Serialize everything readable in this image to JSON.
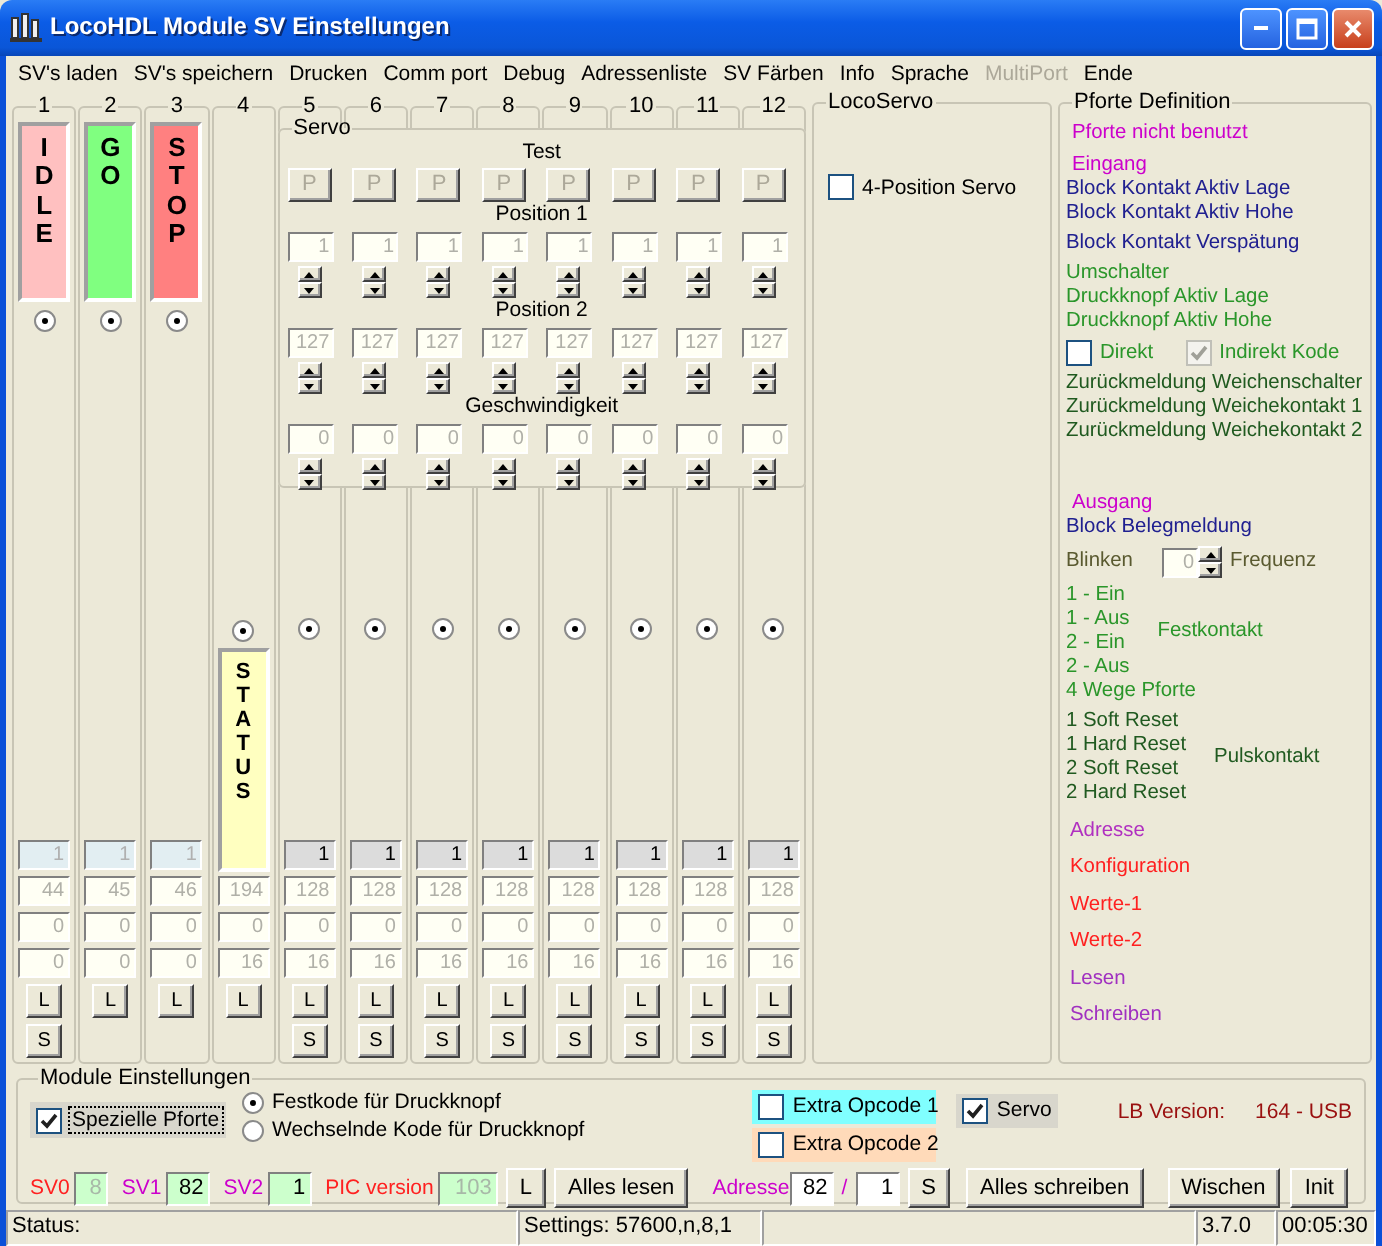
{
  "window": {
    "title": "LocoHDL Module SV Einstellungen"
  },
  "menu": [
    {
      "label": "SV's laden",
      "disabled": false
    },
    {
      "label": "SV's speichern",
      "disabled": false
    },
    {
      "label": "Drucken",
      "disabled": false
    },
    {
      "label": "Comm port",
      "disabled": false
    },
    {
      "label": "Debug",
      "disabled": false
    },
    {
      "label": "Adressenliste",
      "disabled": false
    },
    {
      "label": "SV Färben",
      "disabled": false
    },
    {
      "label": "Info",
      "disabled": false
    },
    {
      "label": "Sprache",
      "disabled": false
    },
    {
      "label": "MultiPort",
      "disabled": true
    },
    {
      "label": "Ende",
      "disabled": false
    }
  ],
  "ports": [
    {
      "number": "1",
      "kind": "state",
      "panel": {
        "text": "IDLE",
        "color": "#ffc0c0"
      },
      "selected": true,
      "top_field": {
        "value": "1",
        "disabled": true
      },
      "fields": [
        "44",
        "0",
        "0"
      ],
      "load": "L",
      "save": "S"
    },
    {
      "number": "2",
      "kind": "state",
      "panel": {
        "text": "GO",
        "color": "#80ff80"
      },
      "selected": true,
      "top_field": {
        "value": "1",
        "disabled": true
      },
      "fields": [
        "45",
        "0",
        "0"
      ],
      "load": "L"
    },
    {
      "number": "3",
      "kind": "state",
      "panel": {
        "text": "STOP",
        "color": "#ff8080"
      },
      "selected": true,
      "top_field": {
        "value": "1",
        "disabled": true
      },
      "fields": [
        "46",
        "0",
        "0"
      ],
      "load": "L"
    },
    {
      "number": "4",
      "kind": "status",
      "panel": {
        "text": "STATUS",
        "color": "#ffffc0"
      },
      "selected": true,
      "fields": [
        "194",
        "0",
        "16"
      ],
      "load": "L"
    },
    {
      "number": "5",
      "kind": "servo",
      "selected": true,
      "top_field": {
        "value": "1",
        "disabled": false
      },
      "fields": [
        "128",
        "0",
        "16"
      ],
      "load": "L",
      "save": "S"
    },
    {
      "number": "6",
      "kind": "servo",
      "selected": true,
      "top_field": {
        "value": "1",
        "disabled": false
      },
      "fields": [
        "128",
        "0",
        "16"
      ],
      "load": "L",
      "save": "S"
    },
    {
      "number": "7",
      "kind": "servo",
      "selected": true,
      "top_field": {
        "value": "1",
        "disabled": false
      },
      "fields": [
        "128",
        "0",
        "16"
      ],
      "load": "L",
      "save": "S"
    },
    {
      "number": "8",
      "kind": "servo",
      "selected": true,
      "top_field": {
        "value": "1",
        "disabled": false
      },
      "fields": [
        "128",
        "0",
        "16"
      ],
      "load": "L",
      "save": "S"
    },
    {
      "number": "9",
      "kind": "servo",
      "selected": true,
      "top_field": {
        "value": "1",
        "disabled": false
      },
      "fields": [
        "128",
        "0",
        "16"
      ],
      "load": "L",
      "save": "S"
    },
    {
      "number": "10",
      "kind": "servo",
      "selected": true,
      "top_field": {
        "value": "1",
        "disabled": false
      },
      "fields": [
        "128",
        "0",
        "16"
      ],
      "load": "L",
      "save": "S"
    },
    {
      "number": "11",
      "kind": "servo",
      "selected": true,
      "top_field": {
        "value": "1",
        "disabled": false
      },
      "fields": [
        "128",
        "0",
        "16"
      ],
      "load": "L",
      "save": "S"
    },
    {
      "number": "12",
      "kind": "servo",
      "selected": true,
      "top_field": {
        "value": "1",
        "disabled": false
      },
      "fields": [
        "128",
        "0",
        "16"
      ],
      "load": "L",
      "save": "S"
    }
  ],
  "servo": {
    "title": "Servo",
    "test_label": "Test",
    "test_buttons": [
      {
        "label": "P",
        "disabled": true
      },
      {
        "label": "P",
        "disabled": true
      },
      {
        "label": "P",
        "disabled": true
      },
      {
        "label": "P",
        "disabled": true
      },
      {
        "label": "P",
        "disabled": true
      },
      {
        "label": "P",
        "disabled": true
      },
      {
        "label": "P",
        "disabled": true
      },
      {
        "label": "P",
        "disabled": true
      }
    ],
    "rows": [
      {
        "label": "Position 1",
        "disabled": true,
        "values": [
          "1",
          "1",
          "1",
          "1",
          "1",
          "1",
          "1",
          "1"
        ]
      },
      {
        "label": "Position 2",
        "disabled": true,
        "values": [
          "127",
          "127",
          "127",
          "127",
          "127",
          "127",
          "127",
          "127"
        ]
      },
      {
        "label": "Geschwindigkeit",
        "disabled": true,
        "values": [
          "0",
          "0",
          "0",
          "0",
          "0",
          "0",
          "0",
          "0"
        ]
      }
    ]
  },
  "loco_servo": {
    "title": "LocoServo",
    "four_position": {
      "label": "4-Position Servo",
      "checked": false
    }
  },
  "port_definition": {
    "title": "Pforte Definition",
    "entries": [
      {
        "kind": "heading",
        "text": "Pforte nicht benutzt",
        "color": "#cc00cc"
      },
      {
        "kind": "heading",
        "text": "Eingang",
        "color": "#cc00cc"
      },
      {
        "kind": "text",
        "text": "Block Kontakt Aktiv Lage",
        "color": "#202090"
      },
      {
        "kind": "text",
        "text": "Block Kontakt Aktiv Hohe",
        "color": "#202090"
      },
      {
        "kind": "spaced",
        "text": "Block Kontakt Verspätung",
        "color": "#202090"
      },
      {
        "kind": "spaced",
        "text": "Umschalter",
        "color": "#2a962a"
      },
      {
        "kind": "text",
        "text": "Druckknopf Aktiv Lage",
        "color": "#2a962a"
      },
      {
        "kind": "text",
        "text": "Druckknopf Aktiv Hohe",
        "color": "#2a962a"
      },
      {
        "kind": "checks",
        "color": "#2a962a",
        "items": [
          {
            "label": "Direkt",
            "checked": false,
            "disabled": false
          },
          {
            "label": "Indirekt Kode",
            "checked": true,
            "disabled": true
          }
        ]
      },
      {
        "kind": "spaced",
        "text": "Zurückmeldung Weichenschalter",
        "color": "#205a20"
      },
      {
        "kind": "text",
        "text": "Zurückmeldung Weichekontakt 1",
        "color": "#205a20"
      },
      {
        "kind": "text",
        "text": "Zurückmeldung Weichekontakt 2",
        "color": "#205a20"
      },
      {
        "kind": "section",
        "text": "Ausgang",
        "color": "#cc00cc"
      },
      {
        "kind": "text",
        "text": "Block Belegmeldung",
        "color": "#202090"
      },
      {
        "kind": "spin",
        "label": "Blinken",
        "value": "0",
        "unit": "Frequenz",
        "color": "#5a5a30"
      },
      {
        "kind": "group",
        "color": "#2a962a",
        "items": [
          "1 - Ein",
          "1 - Aus",
          "2 - Ein",
          "2 - Aus"
        ],
        "side_label": "Festkontakt"
      },
      {
        "kind": "text",
        "text": "4 Wege Pforte",
        "color": "#2a962a"
      },
      {
        "kind": "group",
        "color": "#205a20",
        "items": [
          "1 Soft Reset",
          "1 Hard Reset",
          "2 Soft Reset",
          "2 Hard Reset"
        ],
        "side_label": "Pulskontakt"
      },
      {
        "kind": "action",
        "text": "Adresse",
        "color": "#b030c0"
      },
      {
        "kind": "action",
        "text": "Konfiguration",
        "color": "#ff2020"
      },
      {
        "kind": "action",
        "text": "Werte-1",
        "color": "#ff2020"
      },
      {
        "kind": "action",
        "text": "Werte-2",
        "color": "#ff2020"
      },
      {
        "kind": "action",
        "text": "Lesen",
        "color": "#a030c0"
      },
      {
        "kind": "action",
        "text": "Schreiben",
        "color": "#a030c0"
      }
    ]
  },
  "module_settings": {
    "title": "Module Einstellungen",
    "special_port": {
      "label": "Spezielle Pforte",
      "checked": true
    },
    "button_code": [
      {
        "label": "Festkode für Druckknopf",
        "selected": true
      },
      {
        "label": "Wechselnde Kode für Druckknopf",
        "selected": false
      }
    ],
    "extra_opcodes": [
      {
        "label": "Extra Opcode 1",
        "checked": false,
        "color": "#80ffff"
      },
      {
        "label": "Extra Opcode 2",
        "checked": false,
        "color": "#ffdab9"
      }
    ],
    "servo": {
      "label": "Servo",
      "checked": true
    },
    "lb_version": {
      "label": "LB Version:",
      "value": "164 - USB"
    },
    "sv_fields": [
      {
        "label": "SV0",
        "value": "8",
        "disabled": true,
        "color": "#ff2020"
      },
      {
        "label": "SV1",
        "value": "82",
        "disabled": false,
        "color": "#cc00cc"
      },
      {
        "label": "SV2",
        "value": "1",
        "disabled": false,
        "color": "#cc00cc"
      },
      {
        "label": "PIC version",
        "value": "103",
        "disabled": true,
        "color": "#ff2020"
      }
    ],
    "load_button": "L",
    "read_all": "Alles lesen",
    "address": {
      "label": "Adresse",
      "color": "#cc00cc",
      "value": "82",
      "separator": "/",
      "sub_value": "1"
    },
    "save_button": "S",
    "write_all": "Alles schreiben",
    "clear": "Wischen",
    "init": "Init"
  },
  "status_bar": {
    "status": "Status:",
    "settings": "Settings: 57600,n,8,1",
    "version": "3.7.0",
    "time": "00:05:30"
  }
}
